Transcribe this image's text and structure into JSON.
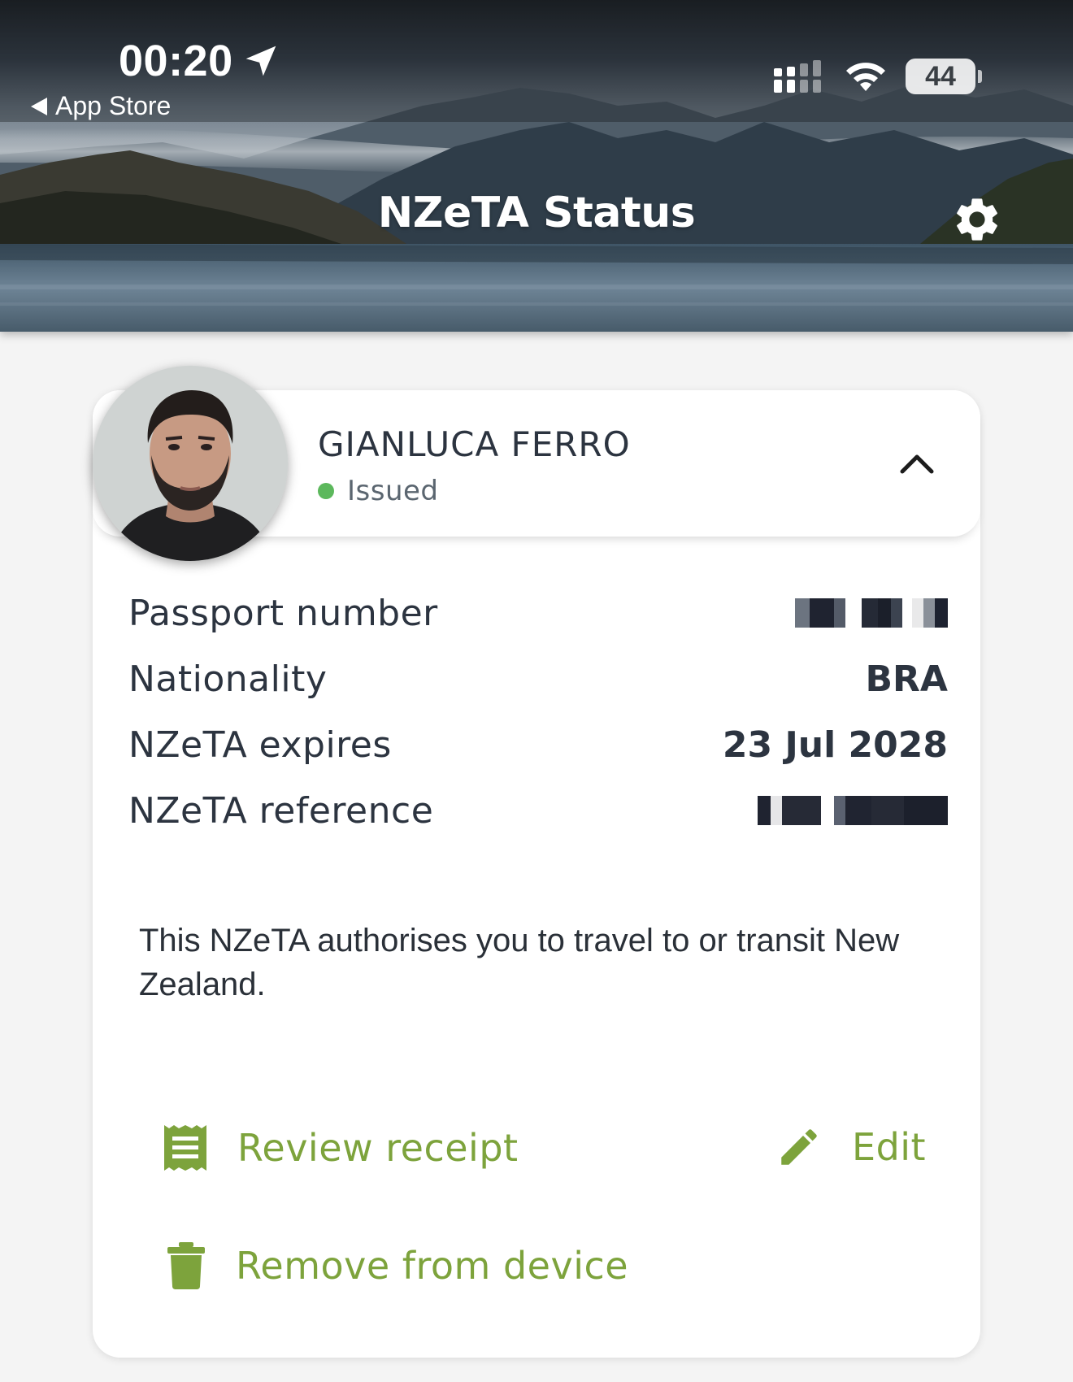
{
  "status_bar": {
    "time": "00:20",
    "back_label": "App Store",
    "battery": "44"
  },
  "header": {
    "title": "NZeTA Status"
  },
  "card": {
    "holder_name": "GIANLUCA FERRO",
    "status": "Issued",
    "details": [
      {
        "label": "Passport number",
        "value": ""
      },
      {
        "label": "Nationality",
        "value": "BRA"
      },
      {
        "label": "NZeTA expires",
        "value": "23 Jul 2028"
      },
      {
        "label": "NZeTA reference",
        "value": ""
      }
    ],
    "description": "This NZeTA authorises you to travel to or transit New Zealand."
  },
  "actions": {
    "review_receipt": "Review receipt",
    "edit": "Edit",
    "remove": "Remove from device"
  },
  "colors": {
    "accent": "#7da33c",
    "status_issued": "#5cb85c",
    "text": "#2c3440"
  },
  "icons": {
    "location": "location-arrow-icon",
    "settings": "gear-icon",
    "collapse": "chevron-up-icon",
    "receipt": "receipt-icon",
    "edit": "pencil-icon",
    "remove": "trash-icon"
  }
}
